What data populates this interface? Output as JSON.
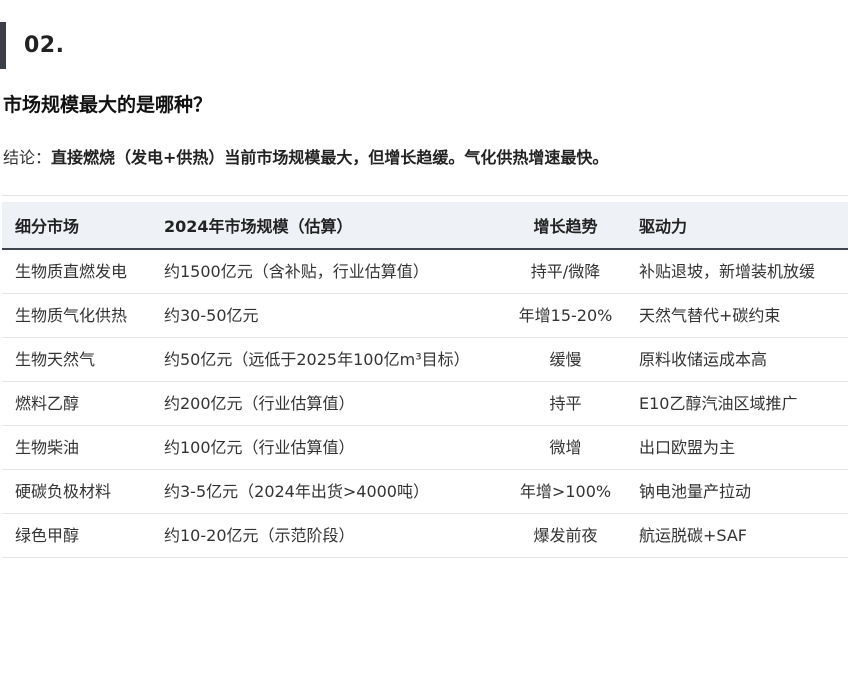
{
  "section": {
    "number": "02."
  },
  "question": "市场规模最大的是哪种？",
  "conclusion": {
    "prefix": "结论：",
    "text": "直接燃烧（发电+供热）当前市场规模最大，但增长趋缓。气化供热增速最快。"
  },
  "table": {
    "headers": [
      "细分市场",
      "2024年市场规模（估算）",
      "增长趋势",
      "驱动力"
    ],
    "rows": [
      [
        "生物质直燃发电",
        "约1500亿元（含补贴，行业估算值）",
        "持平/微降",
        "补贴退坡，新增装机放缓"
      ],
      [
        "生物质气化供热",
        "约30-50亿元",
        "年增15-20%",
        "天然气替代+碳约束"
      ],
      [
        "生物天然气",
        "约50亿元（远低于2025年100亿m³目标）",
        "缓慢",
        "原料收储运成本高"
      ],
      [
        "燃料乙醇",
        "约200亿元（行业估算值）",
        "持平",
        "E10乙醇汽油区域推广"
      ],
      [
        "生物柴油",
        "约100亿元（行业估算值）",
        "微增",
        "出口欧盟为主"
      ],
      [
        "硬碳负极材料",
        "约3-5亿元（2024年出货>4000吨）",
        "年增>100%",
        "钠电池量产拉动"
      ],
      [
        "绿色甲醇",
        "约10-20亿元（示范阶段）",
        "爆发前夜",
        "航运脱碳+SAF"
      ]
    ]
  }
}
